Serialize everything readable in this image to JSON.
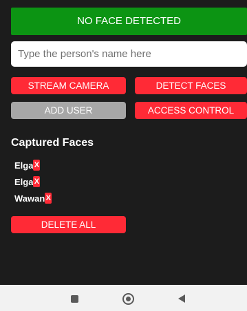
{
  "status": {
    "text": "NO FACE DETECTED",
    "color": "#0c9413"
  },
  "name_input": {
    "placeholder": "Type the person's name here",
    "value": ""
  },
  "buttons": {
    "stream_camera": "STREAM CAMERA",
    "detect_faces": "DETECT FACES",
    "add_user": "ADD USER",
    "access_control": "ACCESS CONTROL",
    "delete_all": "DELETE ALL"
  },
  "captured_faces": {
    "title": "Captured Faces",
    "items": [
      {
        "name": "Elga",
        "delete_label": "X"
      },
      {
        "name": "Elga",
        "delete_label": "X"
      },
      {
        "name": "Wawan",
        "delete_label": "X"
      }
    ]
  },
  "colors": {
    "accent_red": "#ff2a36",
    "disabled_gray": "#a7a7a7",
    "background": "#1c1c1c"
  },
  "navbar": {
    "icons": [
      "recent-apps-icon",
      "home-icon",
      "back-icon"
    ]
  }
}
